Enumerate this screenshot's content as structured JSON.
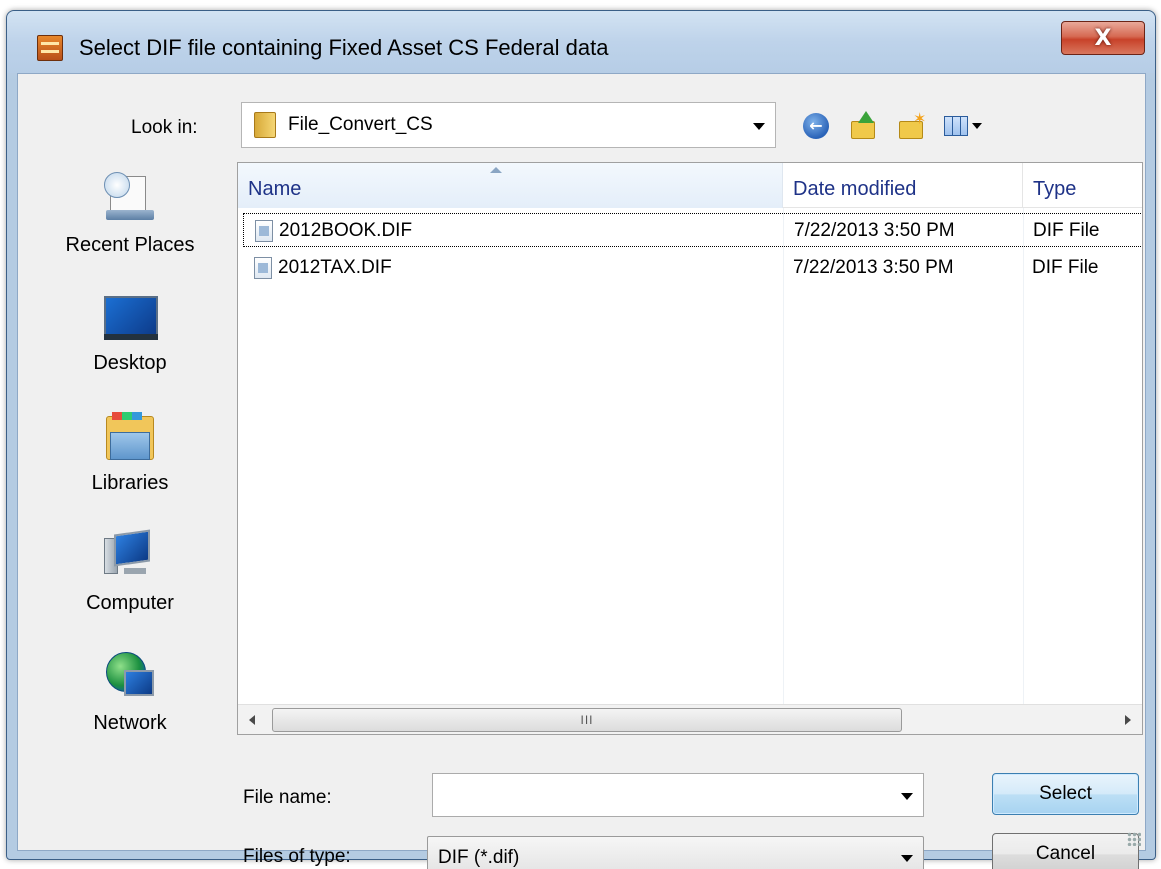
{
  "window": {
    "title": "Select DIF file containing Fixed Asset CS Federal data",
    "close_glyph": "X",
    "app_icon": "asset-keeper-pro-icon"
  },
  "lookin": {
    "label": "Look in:",
    "value": "File_Convert_CS",
    "icon": "folder-icon"
  },
  "toolbar": {
    "back_icon": "back-arrow-icon",
    "up_icon": "up-folder-icon",
    "new_folder_icon": "new-folder-icon",
    "views_icon": "views-menu-icon"
  },
  "places": [
    {
      "label": "Recent Places",
      "icon": "recent-places-icon"
    },
    {
      "label": "Desktop",
      "icon": "desktop-icon"
    },
    {
      "label": "Libraries",
      "icon": "libraries-icon"
    },
    {
      "label": "Computer",
      "icon": "computer-icon"
    },
    {
      "label": "Network",
      "icon": "network-icon"
    }
  ],
  "filelist": {
    "columns": [
      "Name",
      "Date modified",
      "Type"
    ],
    "rows": [
      {
        "name": "2012BOOK.DIF",
        "date": "7/22/2013 3:50 PM",
        "type": "DIF File",
        "focused": true
      },
      {
        "name": "2012TAX.DIF",
        "date": "7/22/2013 3:50 PM",
        "type": "DIF File",
        "focused": false
      }
    ],
    "scroll_grip": "III"
  },
  "form": {
    "filename_label": "File name:",
    "filename_value": "",
    "filetype_label": "Files of type:",
    "filetype_value": "DIF (*.dif)"
  },
  "buttons": {
    "select": "Select",
    "cancel": "Cancel"
  },
  "colors": {
    "title_bar": "#bed3ea",
    "close_button": "#c8422a",
    "header_text": "#1e3287",
    "select_button": "#bcdff5"
  }
}
